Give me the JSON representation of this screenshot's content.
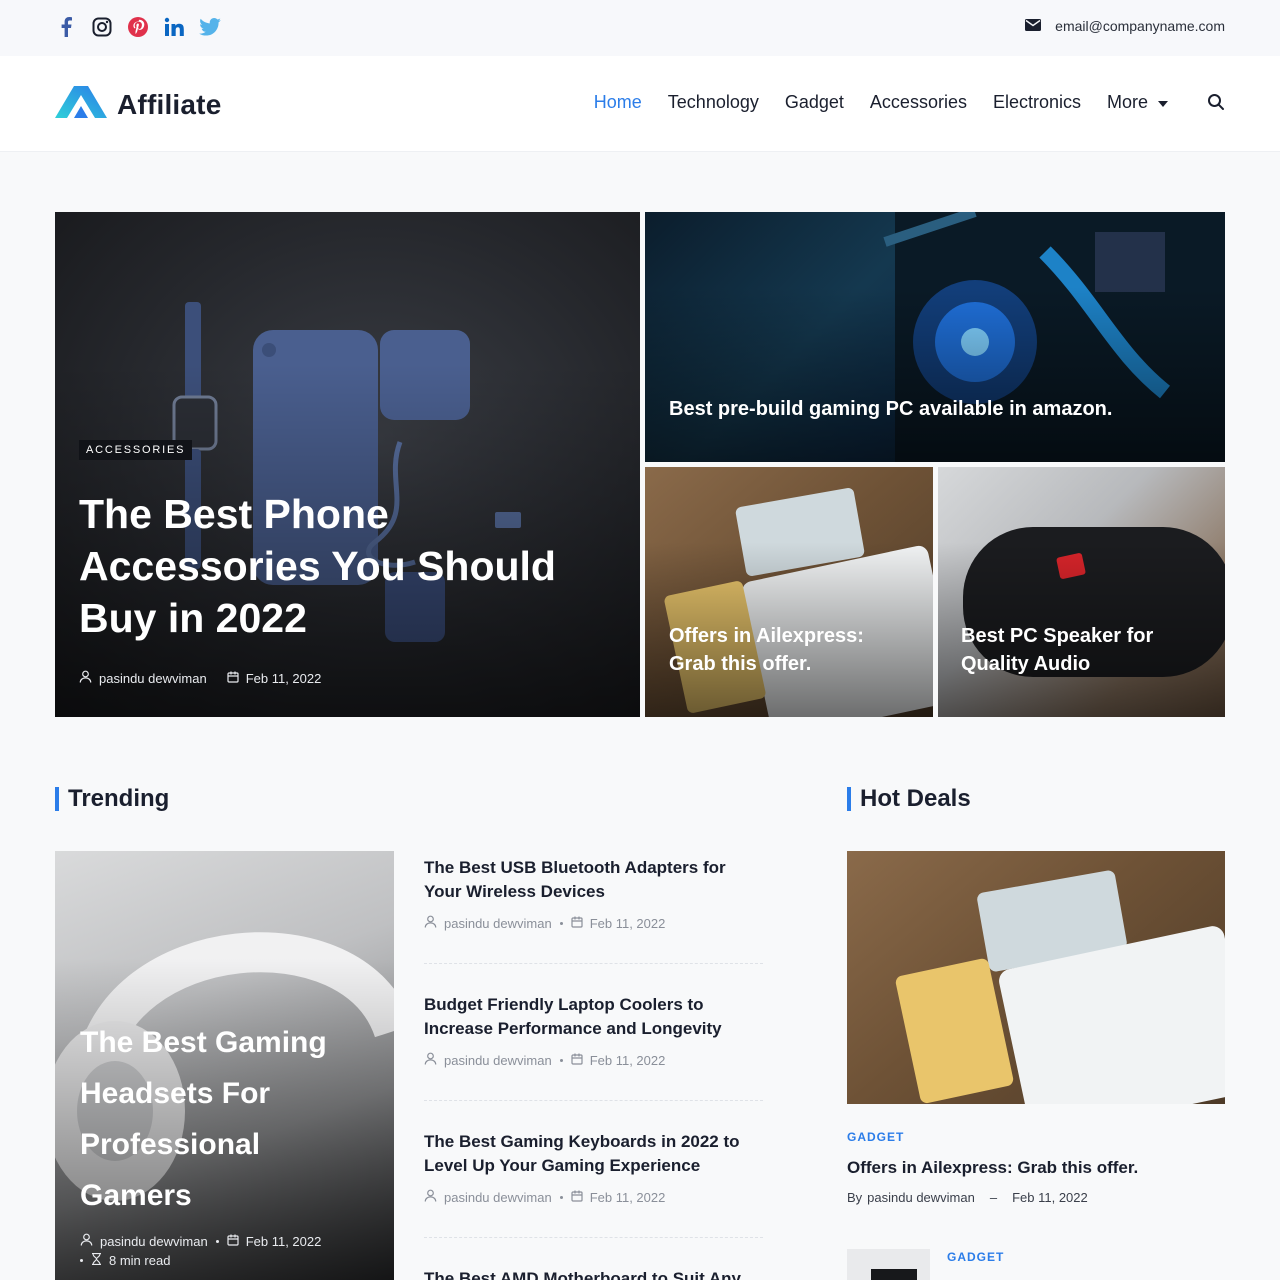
{
  "topbar": {
    "social": [
      "facebook-icon",
      "instagram-icon",
      "pinterest-icon",
      "linkedin-icon",
      "twitter-icon"
    ],
    "email": "email@companyname.com"
  },
  "header": {
    "logo": "Affiliate",
    "nav": [
      "Home",
      "Technology",
      "Gadget",
      "Accessories",
      "Electronics",
      "More"
    ],
    "active_nav": "Home"
  },
  "hero": {
    "main": {
      "category": "ACCESSORIES",
      "title": "The Best Phone Accessories You Should Buy in 2022",
      "author": "pasindu dewviman",
      "date": "Feb 11, 2022"
    },
    "top_right": {
      "title": "Best pre-build gaming PC available in amazon."
    },
    "bottom_left": {
      "title": "Offers in Ailexpress: Grab this offer."
    },
    "bottom_right": {
      "title": "Best PC Speaker for Quality Audio"
    }
  },
  "trending": {
    "heading": "Trending",
    "featured": {
      "title": "The Best Gaming Headsets For Professional Gamers",
      "author": "pasindu dewviman",
      "date": "Feb 11, 2022",
      "read_time": "8 min read"
    },
    "items": [
      {
        "title": "The Best USB Bluetooth Adapters for Your Wireless Devices",
        "author": "pasindu dewviman",
        "date": "Feb 11, 2022"
      },
      {
        "title": "Budget Friendly Laptop Coolers to Increase Performance and Longevity",
        "author": "pasindu dewviman",
        "date": "Feb 11, 2022"
      },
      {
        "title": "The Best Gaming Keyboards in 2022 to Level Up Your Gaming Experience",
        "author": "pasindu dewviman",
        "date": "Feb 11, 2022"
      },
      {
        "title": "The Best AMD Motherboard to Suit Any"
      }
    ]
  },
  "hot_deals": {
    "heading": "Hot Deals",
    "main": {
      "category": "GADGET",
      "title": "Offers in Ailexpress: Grab this offer.",
      "by": "By",
      "author": "pasindu dewviman",
      "sep": "–",
      "date": "Feb 11, 2022"
    },
    "second": {
      "category": "GADGET"
    }
  },
  "colors": {
    "accent": "#2b7de9",
    "text": "#1a1f2e",
    "muted": "#8a8f99"
  }
}
